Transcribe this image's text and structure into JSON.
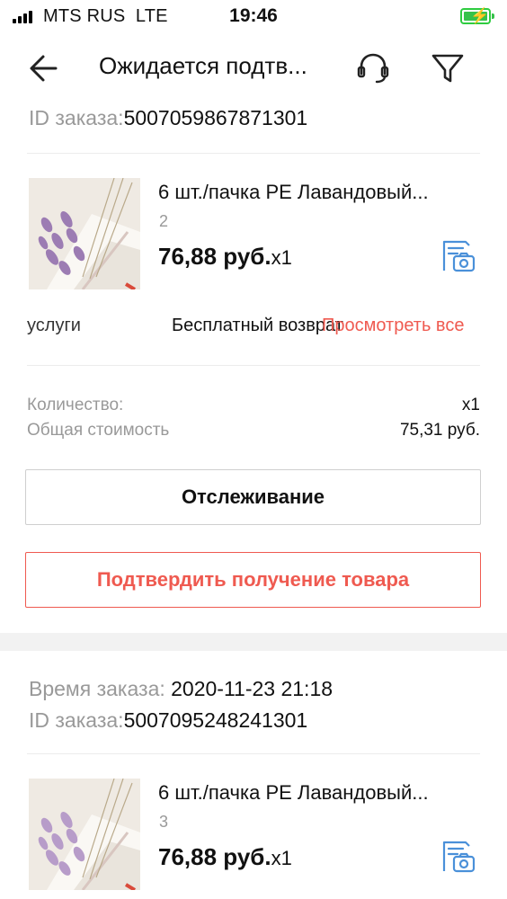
{
  "status_bar": {
    "carrier": "MTS RUS",
    "network": "LTE",
    "time": "19:46",
    "battery_color": "#36c24a"
  },
  "header": {
    "title": "Ожидается подтв...",
    "back_icon": "arrow-left-icon",
    "support_icon": "headset-icon",
    "filter_icon": "funnel-icon"
  },
  "order1": {
    "id_label": "ID заказа:",
    "id_value": "5007059867871301",
    "product": {
      "title": "6 шт./пачка PE Лавандовый...",
      "variant": "2",
      "price": "76,88 руб.",
      "quantity": "x1",
      "review_icon": "photo-review-icon"
    },
    "services": {
      "label": "услуги",
      "value": "Бесплатный возврат",
      "link": "Просмотреть все"
    },
    "summary": {
      "quantity_label": "Количество:",
      "quantity_value": "x1",
      "total_label": "Общая стоимость",
      "total_value": "75,31 руб."
    },
    "buttons": {
      "track": "Отслеживание",
      "confirm": "Подтвердить получение товара"
    }
  },
  "order2": {
    "time_label": "Время заказа:",
    "time_value": "2020-11-23 21:18",
    "id_label": "ID заказа:",
    "id_value": "5007095248241301",
    "product": {
      "title": "6 шт./пачка PE Лавандовый...",
      "variant": "3",
      "price": "76,88 руб.",
      "quantity": "x1",
      "review_icon": "photo-review-icon"
    }
  },
  "colors": {
    "accent_red": "#ef5a50",
    "icon_blue": "#4a90d9",
    "muted_text": "#999999"
  }
}
